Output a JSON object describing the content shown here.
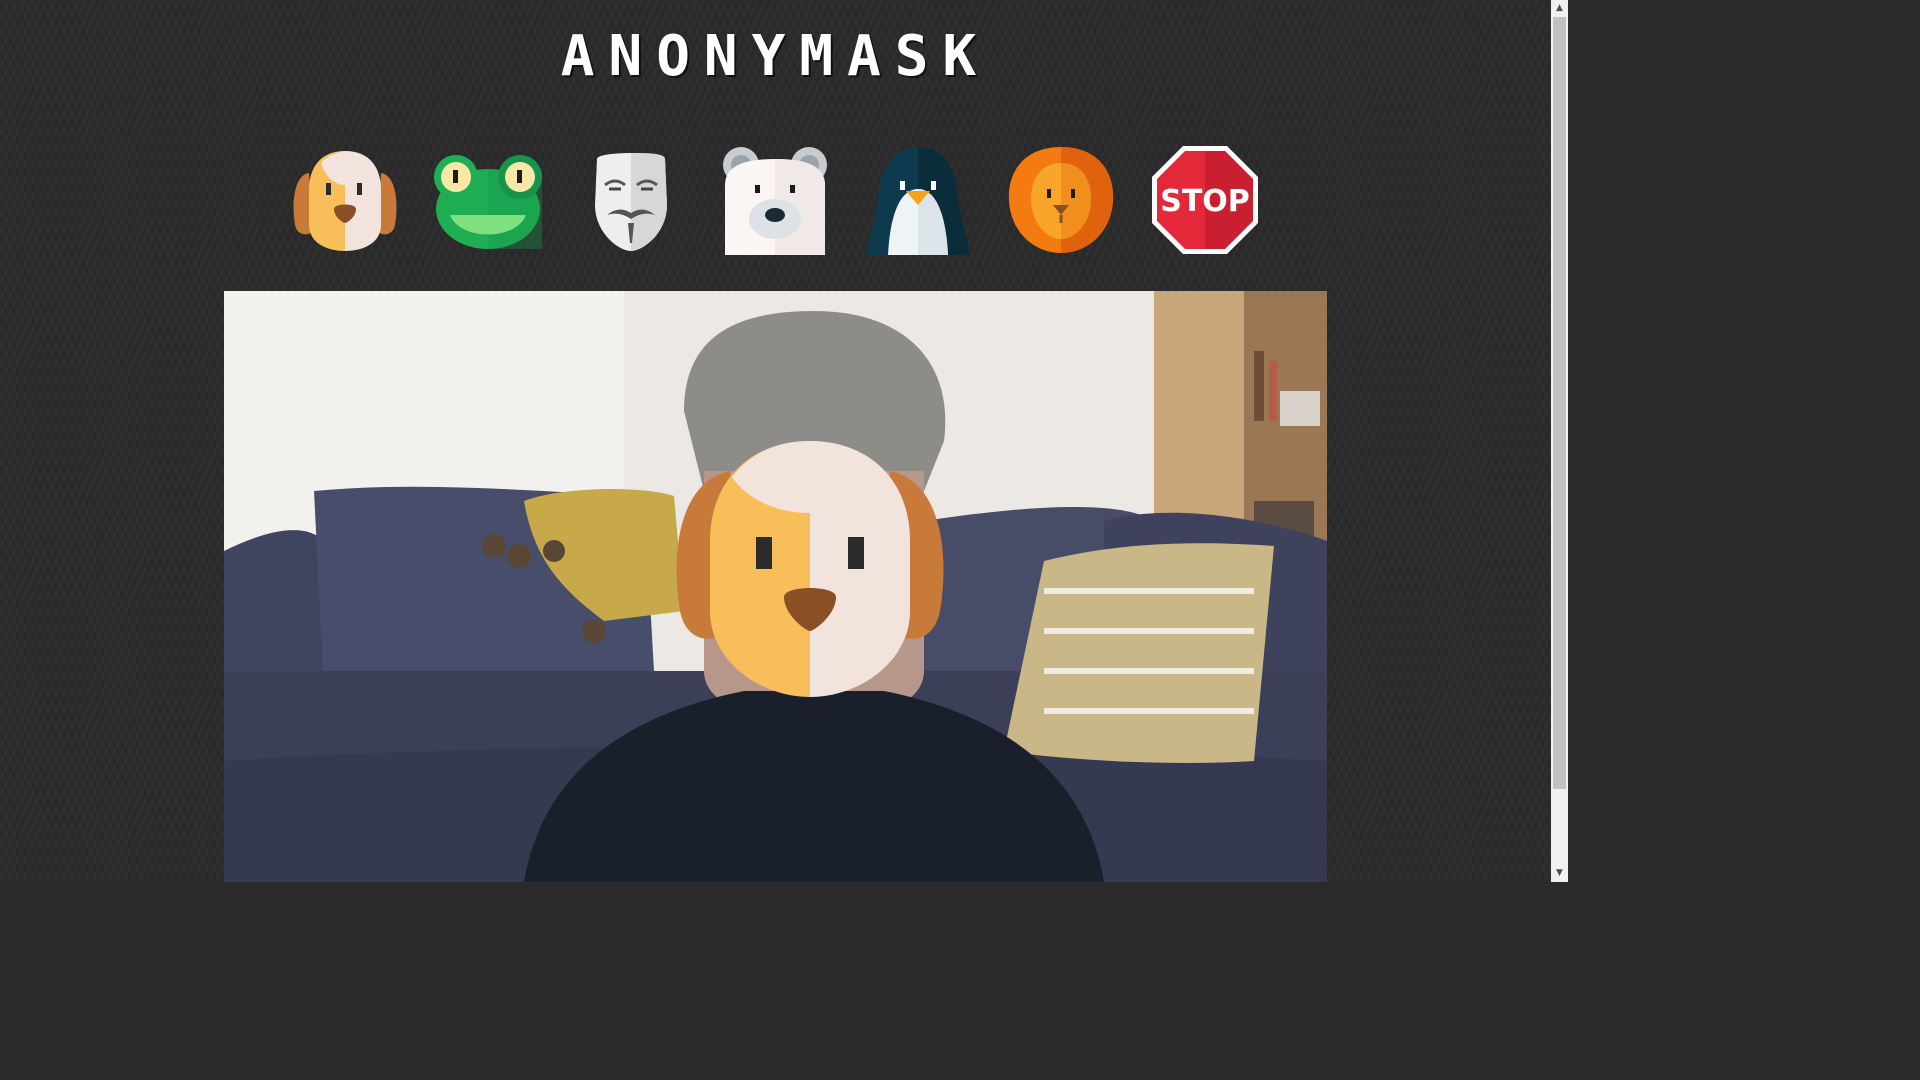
{
  "app": {
    "title": "ANONYMASK"
  },
  "masks": [
    {
      "id": "dog",
      "icon": "dog-icon"
    },
    {
      "id": "frog",
      "icon": "frog-icon"
    },
    {
      "id": "anonymous",
      "icon": "guy-fawkes-mask-icon"
    },
    {
      "id": "polar-bear",
      "icon": "polar-bear-icon"
    },
    {
      "id": "penguin",
      "icon": "penguin-icon"
    },
    {
      "id": "lion",
      "icon": "lion-icon"
    },
    {
      "id": "stop",
      "icon": "stop-sign-icon",
      "label": "STOP"
    }
  ],
  "video": {
    "active_mask": "dog"
  },
  "colors": {
    "background": "#2b2b2b",
    "title": "#ffffff",
    "dog_orange": "#f8be5a",
    "dog_ear": "#c87a3a",
    "frog_green": "#1fae54",
    "lion_orange": "#f47a12",
    "penguin_navy": "#0e3a4d",
    "stop_red": "#e3283a"
  }
}
